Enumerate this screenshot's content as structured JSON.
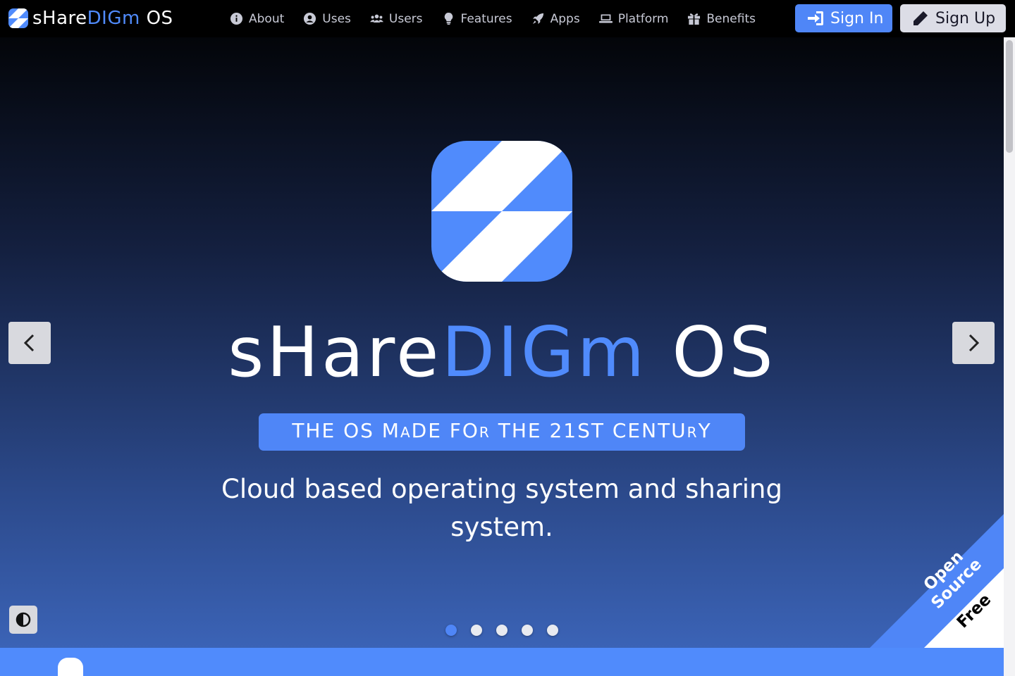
{
  "brand": {
    "name_part1": "sHare",
    "name_part2": "DIGm",
    "name_part3": " OS"
  },
  "nav": {
    "items": [
      {
        "label": "About",
        "icon": "info-circle-icon"
      },
      {
        "label": "Uses",
        "icon": "user-circle-icon"
      },
      {
        "label": "Users",
        "icon": "users-icon"
      },
      {
        "label": "Features",
        "icon": "lightbulb-icon"
      },
      {
        "label": "Apps",
        "icon": "rocket-icon"
      },
      {
        "label": "Platform",
        "icon": "laptop-icon"
      },
      {
        "label": "Benefits",
        "icon": "gift-icon"
      }
    ],
    "signin_label": "Sign In",
    "signup_label": "Sign Up"
  },
  "hero": {
    "title_part1": "sHare",
    "title_part2": "DIGm",
    "title_part3": " OS",
    "tagline": "THE OS MaDE FOr THE 21ST CENTUrY",
    "subtitle": "Cloud based operating system and sharing system.",
    "active_slide": 1,
    "slide_count": 5
  },
  "ribbon": {
    "line1": "Open Source",
    "line2": "Free"
  },
  "colors": {
    "accent": "#4f86f7",
    "navbar_bg": "#000000",
    "hero_top": "#030509",
    "hero_bottom": "#3b63b6"
  }
}
